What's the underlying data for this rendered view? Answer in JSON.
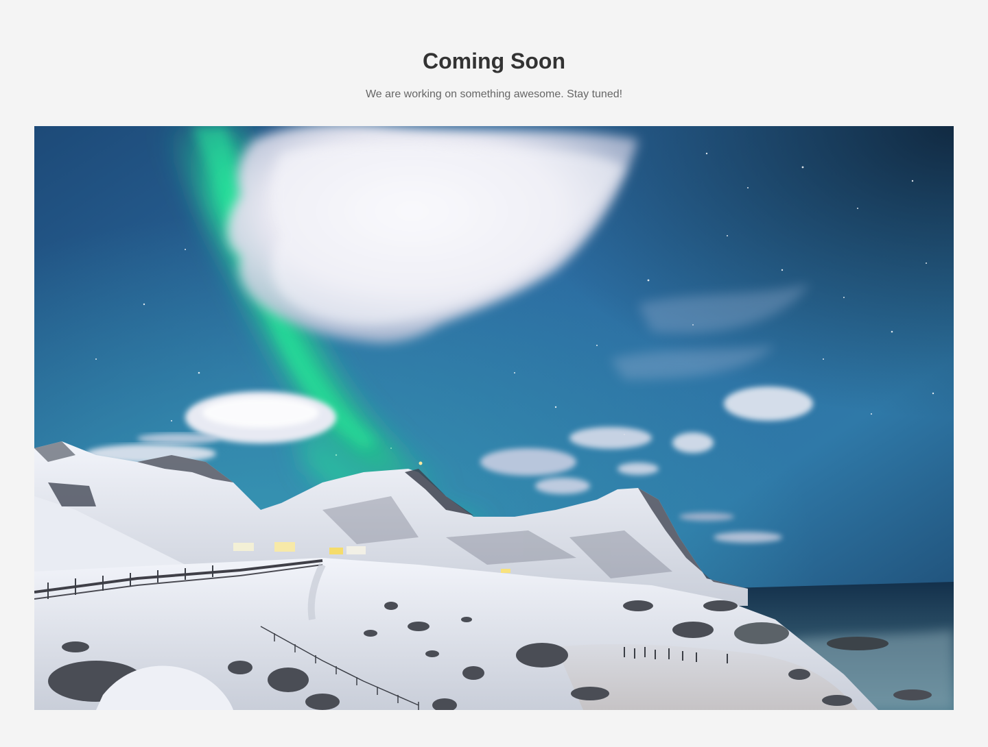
{
  "header": {
    "title": "Coming Soon",
    "subtitle": "We are working on something awesome. Stay tuned!"
  },
  "hero": {
    "subject": "aurora-mountain-landscape-image"
  }
}
